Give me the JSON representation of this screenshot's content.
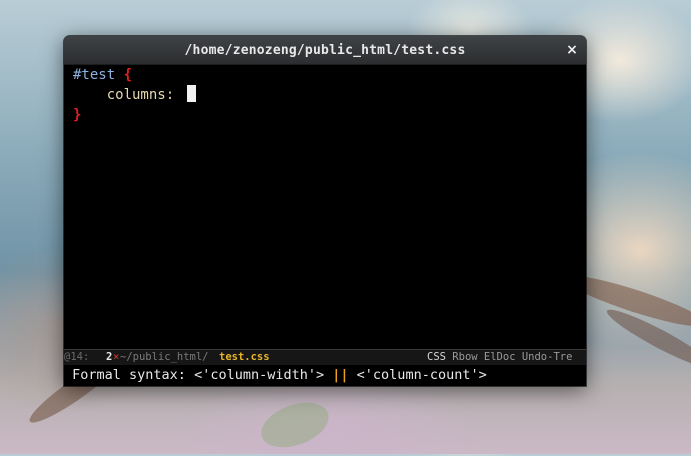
{
  "window": {
    "title": "/home/zenozeng/public_html/test.css",
    "close_glyph": "×"
  },
  "editor": {
    "selector": "#test",
    "open_brace": "{",
    "property": "columns:",
    "close_brace": "}"
  },
  "modeline": {
    "position": "@14:",
    "window_number": "2",
    "modified_flag": "×",
    "directory": "~/public_html/",
    "filename": "test.css",
    "major_mode": "CSS",
    "minor_modes": "Rbow ElDoc Undo-Tre"
  },
  "echo_area": {
    "label": "Formal syntax:",
    "value_a": "<'column-width'>",
    "separator": "||",
    "value_b": "<'column-count'>"
  },
  "colors": {
    "selector": "#8cb2e0",
    "brace": "#e0201c",
    "property": "#e6d9ad",
    "filename": "#e6b428",
    "separator": "#e8a020"
  }
}
